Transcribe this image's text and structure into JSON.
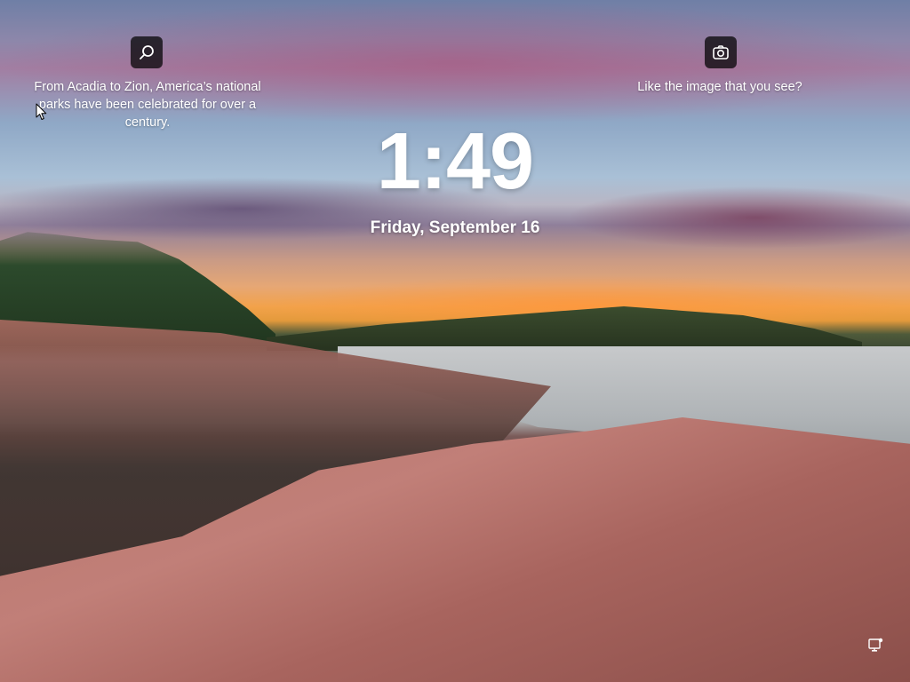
{
  "lockscreen": {
    "spotlight_left": {
      "icon": "search-icon",
      "caption": "From Acadia to Zion, America’s national parks have been celebrated for over a century."
    },
    "spotlight_right": {
      "icon": "camera-icon",
      "caption": "Like the image that you see?"
    },
    "time": "1:49",
    "date": "Friday, September 16",
    "status": {
      "network_icon": "network-icon"
    }
  },
  "colors": {
    "chip_background": "#000000",
    "text": "#ffffff"
  }
}
